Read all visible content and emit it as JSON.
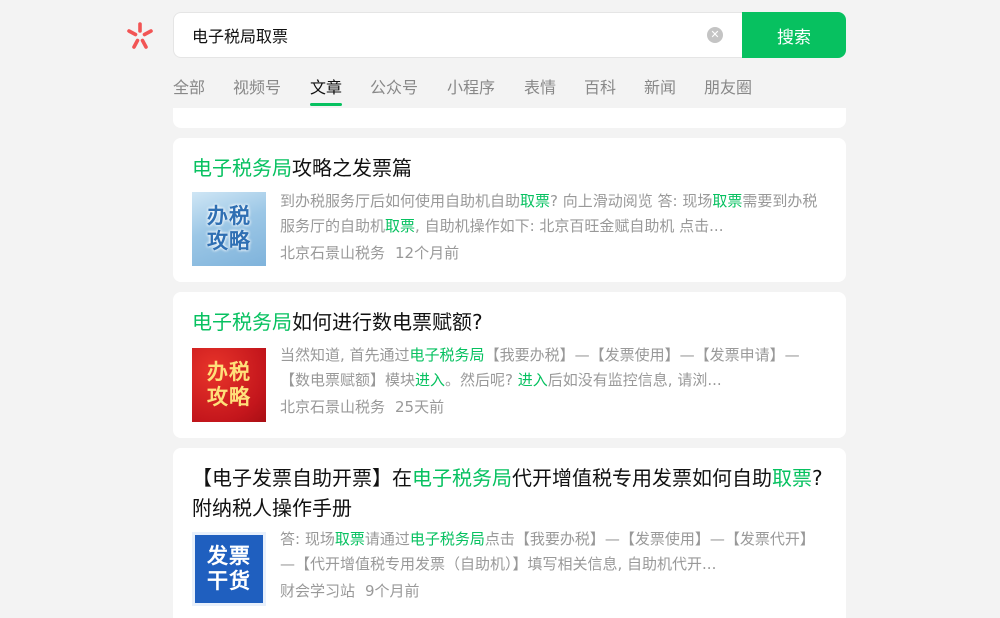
{
  "search": {
    "query": "电子税局取票",
    "button_label": "搜索"
  },
  "tabs": [
    {
      "label": "全部"
    },
    {
      "label": "视频号"
    },
    {
      "label": "文章"
    },
    {
      "label": "公众号"
    },
    {
      "label": "小程序"
    },
    {
      "label": "表情"
    },
    {
      "label": "百科"
    },
    {
      "label": "新闻"
    },
    {
      "label": "朋友圈"
    }
  ],
  "active_tab": "文章",
  "accent_color": "#07c160",
  "results": [
    {
      "title_parts": [
        [
          "电子税务局",
          true
        ],
        [
          "攻略之发票篇",
          false
        ]
      ],
      "thumb_text": "办税\n攻略",
      "snippet_parts": [
        [
          "到办税服务厅后如何使用自助机自助",
          false
        ],
        [
          "取票",
          true
        ],
        [
          "? 向上滑动阅览 答: 现场",
          false
        ],
        [
          "取票",
          true
        ],
        [
          "需要到办税服务厅的自助机",
          false
        ],
        [
          "取票",
          true
        ],
        [
          ", 自助机操作如下: 北京百旺金赋自助机 点击...",
          false
        ]
      ],
      "source": "北京石景山税务",
      "time": "12个月前"
    },
    {
      "title_parts": [
        [
          "电子税务局",
          true
        ],
        [
          "如何进行数电票赋额?",
          false
        ]
      ],
      "thumb_text": "办税\n攻略",
      "snippet_parts": [
        [
          "当然知道, 首先通过",
          false
        ],
        [
          "电子税务局",
          true
        ],
        [
          "【我要办税】—【发票使用】—【发票申请】—【数电票赋额】模块",
          false
        ],
        [
          "进入",
          true
        ],
        [
          "。然后呢? ",
          false
        ],
        [
          "进入",
          true
        ],
        [
          "后如没有监控信息, 请浏...",
          false
        ]
      ],
      "source": "北京石景山税务",
      "time": "25天前"
    },
    {
      "title_parts": [
        [
          "【电子发票自助开票】在",
          false
        ],
        [
          "电子税务局",
          true
        ],
        [
          "代开增值税专用发票如何自助",
          false
        ],
        [
          "取票",
          true
        ],
        [
          "? 附纳税人操作手册",
          false
        ]
      ],
      "thumb_text": "发票\n干货",
      "snippet_parts": [
        [
          "答: 现场",
          false
        ],
        [
          "取票",
          true
        ],
        [
          "请通过",
          false
        ],
        [
          "电子税务局",
          true
        ],
        [
          "点击【我要办税】—【发票使用】—【发票代开】—【代开增值税专用发票（自助机）】填写相关信息, 自助机代开...",
          false
        ]
      ],
      "source": "财会学习站",
      "time": "9个月前"
    }
  ]
}
